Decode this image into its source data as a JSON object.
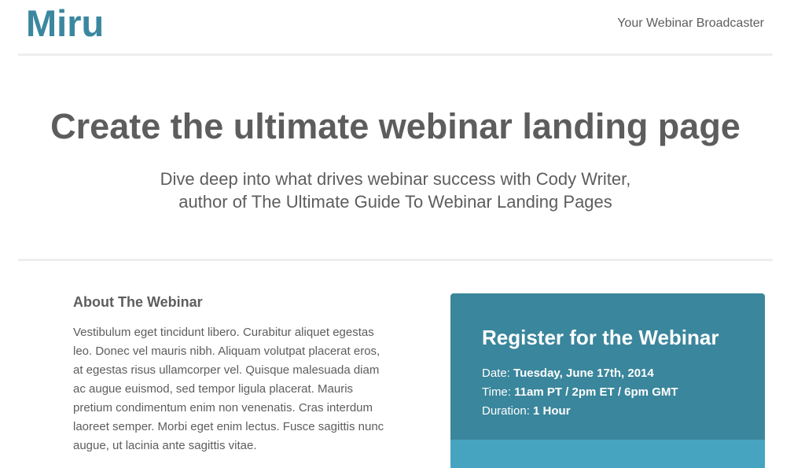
{
  "header": {
    "logo": "Miru",
    "tagline": "Your Webinar Broadcaster"
  },
  "hero": {
    "title": "Create the ultimate webinar landing page",
    "subtitle_line1": "Dive deep into what drives webinar success with Cody Writer,",
    "subtitle_line2": "author of The Ultimate Guide To Webinar Landing Pages"
  },
  "about": {
    "heading": "About The Webinar",
    "body": "Vestibulum eget tincidunt libero. Curabitur aliquet egestas leo. Donec vel mauris nibh. Aliquam volutpat placerat eros, at egestas risus ullamcorper vel. Quisque malesuada diam ac augue euismod, sed tempor ligula placerat. Mauris pretium condimentum enim non venenatis. Cras interdum laoreet semper. Morbi eget enim lectus. Fusce sagittis nunc augue, ut lacinia ante sagittis vitae."
  },
  "register": {
    "title": "Register for the Webinar",
    "date_label": "Date:",
    "date_value": "Tuesday, June 17th, 2014",
    "time_label": "Time:",
    "time_value": "11am PT / 2pm ET / 6pm GMT",
    "duration_label": "Duration:",
    "duration_value": "1 Hour"
  },
  "colors": {
    "brand": "#3b87a0",
    "card_top": "#3a869c",
    "card_bottom": "#46a4c0",
    "text": "#5d5d5d",
    "divider": "#eeeeee"
  }
}
